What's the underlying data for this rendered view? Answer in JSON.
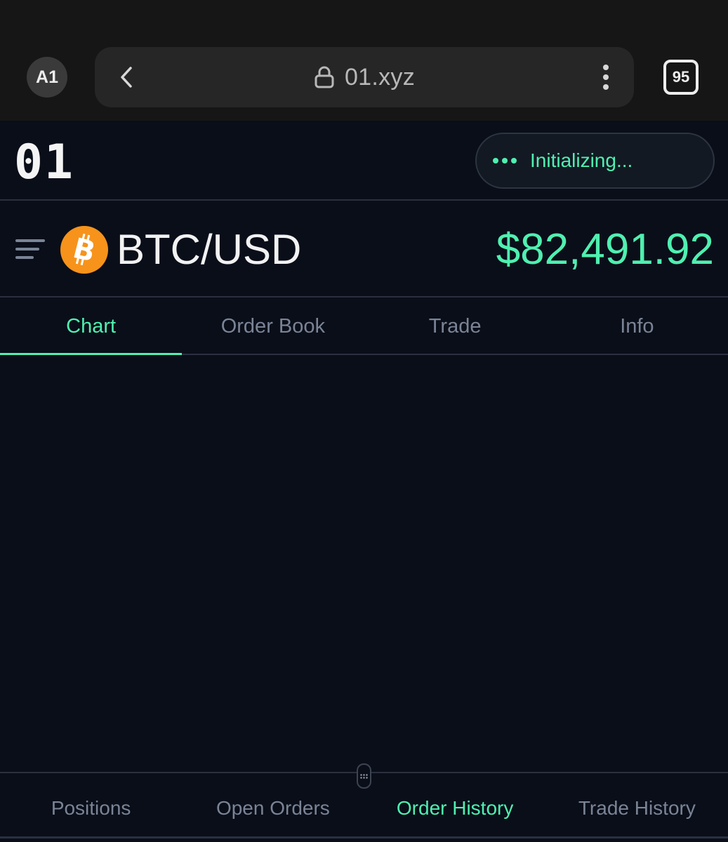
{
  "browser": {
    "profile_label": "A1",
    "url": "01.xyz",
    "tab_count": "95"
  },
  "header": {
    "logo": "01",
    "status_text": "Initializing..."
  },
  "market": {
    "pair": "BTC/USD",
    "price": "$82,491.92",
    "coin_icon": "bitcoin-icon",
    "price_color": "#4ff0b0",
    "coin_color": "#f7931a"
  },
  "tabs": [
    {
      "label": "Chart",
      "active": true
    },
    {
      "label": "Order Book",
      "active": false
    },
    {
      "label": "Trade",
      "active": false
    },
    {
      "label": "Info",
      "active": false
    }
  ],
  "bottom_tabs": [
    {
      "label": "Positions",
      "active": false
    },
    {
      "label": "Open Orders",
      "active": false
    },
    {
      "label": "Order History",
      "active": true
    },
    {
      "label": "Trade History",
      "active": false
    }
  ],
  "colors": {
    "accent": "#4ff0b0",
    "background": "#0a0e19",
    "muted_text": "#7a8496"
  }
}
